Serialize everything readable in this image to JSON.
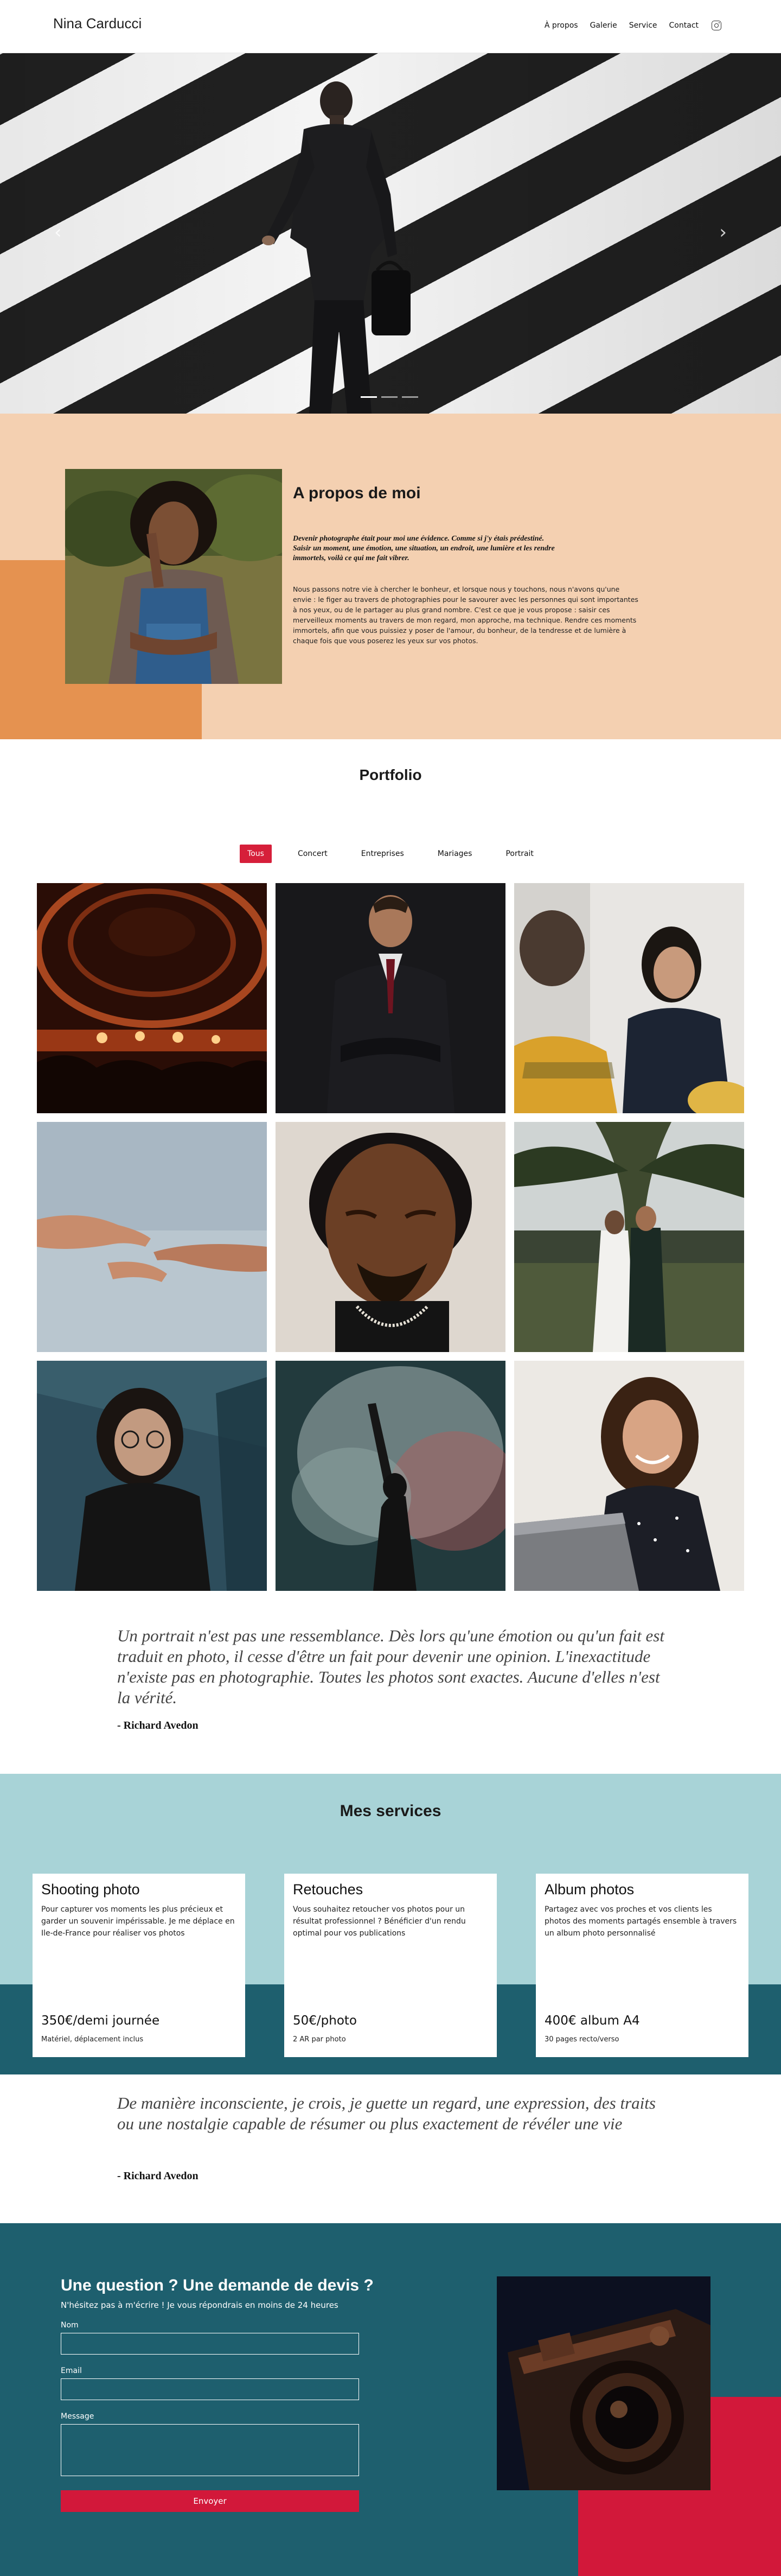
{
  "header": {
    "brand": "Nina Carducci",
    "nav": [
      "À propos",
      "Galerie",
      "Service",
      "Contact"
    ]
  },
  "hero": {
    "slides_total": 3,
    "active_slide": 1
  },
  "about": {
    "title": "A propos de moi",
    "lead": "Devenir photographe était pour moi une évidence. Comme si j'y étais prédestiné. Saisir un moment, une émotion, une situation, un endroit, une lumière et les rendre immortels, voilà ce qui me fait vibrer.",
    "text": "Nous passons notre vie à chercher le bonheur, et lorsque nous y touchons, nous n'avons qu'une envie : le figer au travers de photographies pour le savourer avec les personnes qui sont importantes à nos yeux, ou de le partager au plus grand nombre. C'est ce que je vous propose : saisir ces merveilleux moments au travers de mon regard, mon approche, ma technique. Rendre ces moments immortels, afin que vous puissiez y poser de l'amour, du bonheur, de la tendresse et de lumière à chaque fois que vous poserez les yeux sur vos photos."
  },
  "portfolio": {
    "title": "Portfolio",
    "filters": [
      "Tous",
      "Concert",
      "Entreprises",
      "Mariages",
      "Portrait"
    ],
    "active_filter": "Tous",
    "images": [
      {
        "name": "concert-stage"
      },
      {
        "name": "businessman-suit"
      },
      {
        "name": "business-meeting"
      },
      {
        "name": "hands-reaching"
      },
      {
        "name": "man-portrait-closed-eyes"
      },
      {
        "name": "wedding-couple"
      },
      {
        "name": "woman-glasses-portrait"
      },
      {
        "name": "concert-dancer-smoke"
      },
      {
        "name": "woman-laughing-laptop"
      }
    ]
  },
  "quotes": [
    {
      "text": "Un portrait n'est pas une ressemblance. Dès lors qu'une émotion ou qu'un fait est traduit en photo, il cesse d'être un fait pour devenir une opinion. L'inexactitude n'existe pas en photographie. Toutes les photos sont exactes. Aucune d'elles n'est la vérité.",
      "author": "- Richard Avedon"
    },
    {
      "text": "De manière inconsciente, je crois, je guette un regard, une expression, des traits ou une nostalgie capable de résumer ou plus exactement de révéler une vie",
      "author": "- Richard Avedon"
    }
  ],
  "services": {
    "title": "Mes services",
    "cards": [
      {
        "title": "Shooting photo",
        "desc": "Pour capturer vos moments les plus précieux et garder un souvenir impérissable. Je me déplace en Ile-de-France pour réaliser vos photos",
        "price": "350€/demi journée",
        "note": "Matériel, déplacement inclus"
      },
      {
        "title": "Retouches",
        "desc": "Vous souhaitez retoucher vos photos pour un résultat professionnel ? Bénéficier d'un rendu optimal pour vos publications",
        "price": "50€/photo",
        "note": "2 AR par photo"
      },
      {
        "title": "Album photos",
        "desc": "Partagez avec vos proches et vos clients les photos des moments partagés ensemble à travers un album photo personnalisé",
        "price": "400€ album A4",
        "note": "30 pages recto/verso"
      }
    ]
  },
  "contact": {
    "title": "Une question ? Une demande de devis ?",
    "subtitle": "N'hésitez pas à m'écrire ! Je vous répondrais en moins de 24 heures",
    "name_label": "Nom",
    "email_label": "Email",
    "message_label": "Message",
    "name_value": "",
    "email_value": "",
    "message_value": "",
    "submit_label": "Envoyer"
  },
  "colors": {
    "accent": "#d61f3a",
    "about_bg": "#f4d0b1",
    "about_block": "#e59250",
    "services_bg": "#a8d3d7",
    "teal": "#1e5f6e"
  }
}
